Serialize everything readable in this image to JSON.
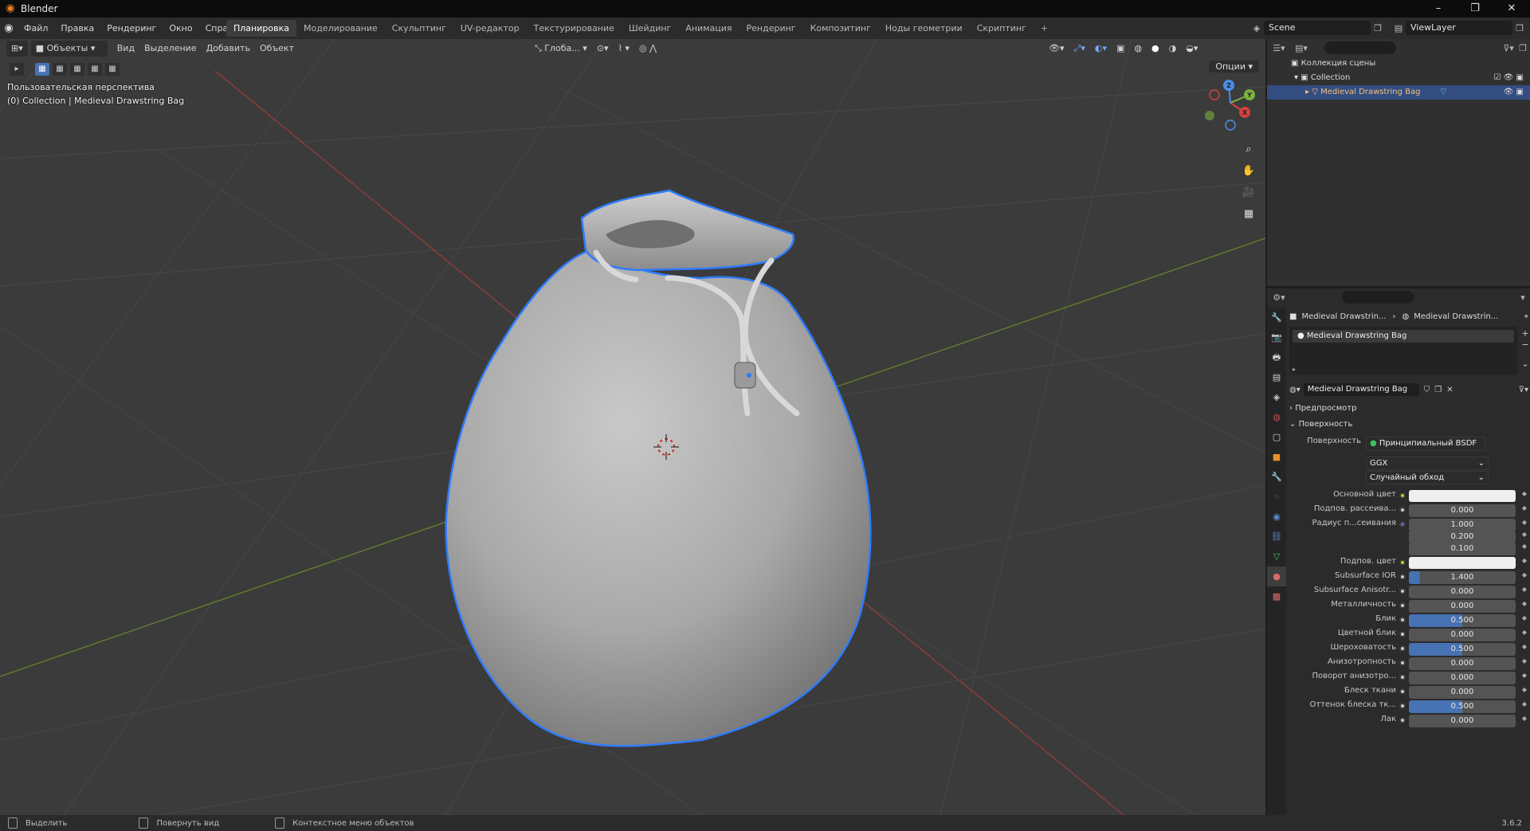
{
  "app": {
    "title": "Blender",
    "version": "3.6.2"
  },
  "window_controls": {
    "minimize": "–",
    "maximize": "❐",
    "close": "✕"
  },
  "menu": [
    "Файл",
    "Правка",
    "Рендеринг",
    "Окно",
    "Справка"
  ],
  "workspaces": [
    {
      "label": "Планировка",
      "active": true
    },
    {
      "label": "Моделирование"
    },
    {
      "label": "Скульптинг"
    },
    {
      "label": "UV-редактор"
    },
    {
      "label": "Текстурирование"
    },
    {
      "label": "Шейдинг"
    },
    {
      "label": "Анимация"
    },
    {
      "label": "Рендеринг"
    },
    {
      "label": "Композитинг"
    },
    {
      "label": "Ноды геометрии"
    },
    {
      "label": "Скриптинг"
    },
    {
      "label": "+"
    }
  ],
  "scene": {
    "name": "Scene",
    "view_layer": "ViewLayer"
  },
  "viewport": {
    "mode": "Объекты",
    "menu": [
      "Вид",
      "Выделение",
      "Добавить",
      "Объект"
    ],
    "orientation": "Глоба...",
    "options": "Опции",
    "overlay_line1": "Пользовательская перспектива",
    "overlay_line2": "(0) Collection | Medieval Drawstring Bag",
    "gizmo": {
      "x": "X",
      "y": "Y",
      "z": "Z"
    }
  },
  "outliner": {
    "root": "Коллекция сцены",
    "collection": "Collection",
    "object": "Medieval Drawstring Bag"
  },
  "properties": {
    "breadcrumb_object": "Medieval Drawstrin...",
    "breadcrumb_material": "Medieval Drawstrin...",
    "slot": "Medieval Drawstring Bag",
    "material_name": "Medieval Drawstring Bag",
    "panel_preview": "Предпросмотр",
    "panel_surface": "Поверхность",
    "surface_label": "Поверхность",
    "surface_value": "Принципиальный BSDF",
    "distribution": "GGX",
    "sss_method": "Случайный обход",
    "rows": [
      {
        "label": "Основной цвет",
        "type": "color",
        "dot": "y"
      },
      {
        "label": "Подпов. рассеива...",
        "value": "0.000"
      },
      {
        "label": "Радиус п...сеивания",
        "value": "1.000",
        "dot": "p"
      },
      {
        "label": "",
        "value": "0.200",
        "nodot": true
      },
      {
        "label": "",
        "value": "0.100",
        "nodot": true
      },
      {
        "label": "Подпов. цвет",
        "type": "color",
        "dot": "y"
      },
      {
        "label": "Subsurface IOR",
        "value": "1.400",
        "fill": 0.1
      },
      {
        "label": "Subsurface Anisotr...",
        "value": "0.000"
      },
      {
        "label": "Металличность",
        "value": "0.000"
      },
      {
        "label": "Блик",
        "value": "0.500",
        "fill": 0.5
      },
      {
        "label": "Цветной блик",
        "value": "0.000"
      },
      {
        "label": "Шероховатость",
        "value": "0.500",
        "fill": 0.5
      },
      {
        "label": "Анизотропность",
        "value": "0.000"
      },
      {
        "label": "Поворот анизотро...",
        "value": "0.000"
      },
      {
        "label": "Блеск ткани",
        "value": "0.000"
      },
      {
        "label": "Оттенок блеска тк...",
        "value": "0.500",
        "fill": 0.5
      },
      {
        "label": "Лак",
        "value": "0.000"
      }
    ]
  },
  "status": {
    "select": "Выделить",
    "rotate": "Повернуть вид",
    "context": "Контекстное меню объектов"
  },
  "colors": {
    "accent": "#4772b3",
    "selection_outline": "#2f7cff",
    "axis_x": "#d3413f",
    "axis_y": "#7ab33d"
  }
}
